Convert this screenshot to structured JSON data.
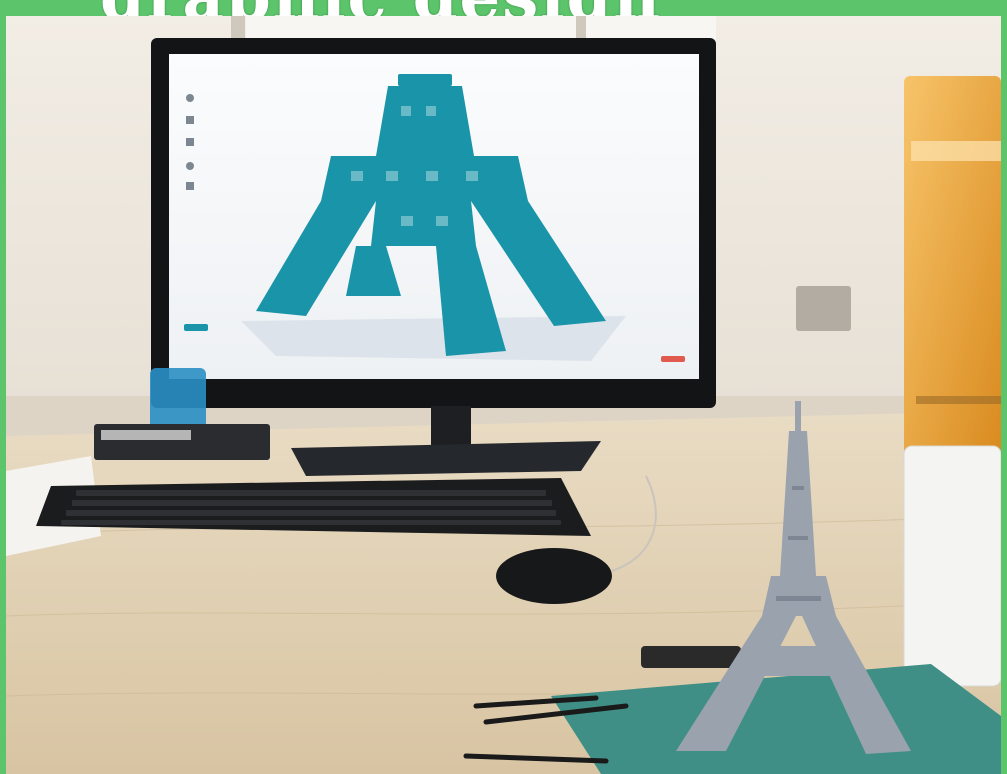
{
  "banner": {
    "text": "graphic design"
  },
  "palette": {
    "frame_green": "#5cc46a",
    "model_teal": "#1994a8",
    "desk_wood": "#e2d2b4",
    "printer_orange": "#f0a63a",
    "mat_teal": "#3f8f86",
    "tower_grey": "#9aa2ae"
  },
  "icons": {
    "keyboard": "keyboard-icon",
    "mouse": "mouse-icon"
  }
}
